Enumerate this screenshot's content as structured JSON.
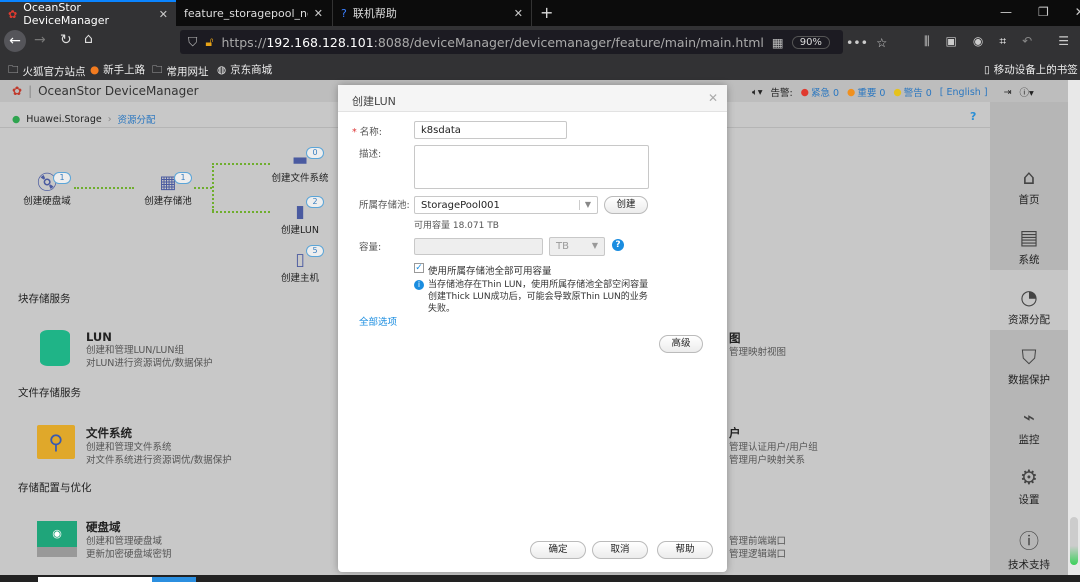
{
  "browser": {
    "tabs": [
      {
        "label": "OceanStor DeviceManager",
        "active": true
      },
      {
        "label": "feature_storagepool_normal.png",
        "active": false
      },
      {
        "label": "联机帮助",
        "active": false
      }
    ],
    "url_prefix": "https://",
    "url_host": "192.168.128.101",
    "url_rest": ":8088/deviceManager/devicemanager/feature/main/main.html",
    "zoom": "90%",
    "bookmarks": [
      "火狐官方站点",
      "新手上路",
      "常用网址",
      "京东商城"
    ],
    "mobile_bookmarks": "移动设备上的书签"
  },
  "app": {
    "title": "OceanStor DeviceManager",
    "alarm_label": "告警:",
    "alarms": [
      {
        "label": "紧急 0",
        "color": "#e03a2f"
      },
      {
        "label": "重要 0",
        "color": "#f0901e"
      },
      {
        "label": "警告 0",
        "color": "#e6c21c"
      }
    ],
    "language": "[ English ]",
    "breadcrumb": {
      "root": "Huawei.Storage",
      "current": "资源分配"
    },
    "help": "?"
  },
  "flow": {
    "nodes": [
      {
        "label": "创建硬盘域",
        "count": "1"
      },
      {
        "label": "创建存储池",
        "count": "1"
      },
      {
        "label": "创建文件系统",
        "count": "0"
      },
      {
        "label": "创建LUN",
        "count": "2"
      },
      {
        "label": "创建主机",
        "count": "5"
      }
    ]
  },
  "sections": [
    {
      "title": "块存储服务",
      "card": {
        "title": "LUN",
        "desc1": "创建和管理LUN/LUN组",
        "desc2": "对LUN进行资源调优/数据保护"
      },
      "right": {
        "title": "图",
        "desc1": "管理映射视图",
        "desc2": ""
      }
    },
    {
      "title": "文件存储服务",
      "card": {
        "title": "文件系统",
        "desc1": "创建和管理文件系统",
        "desc2": "对文件系统进行资源调优/数据保护"
      },
      "right": {
        "title": "户",
        "desc1": "管理认证用户/用户组",
        "desc2": "管理用户映射关系"
      }
    },
    {
      "title": "存储配置与优化",
      "card": {
        "title": "硬盘域",
        "desc1": "创建和管理硬盘域",
        "desc2": "更新加密硬盘域密钥"
      },
      "right": {
        "title": "",
        "desc1": "管理前端端口",
        "desc2": "管理逻辑端口"
      }
    }
  ],
  "sidebar": {
    "items": [
      {
        "label": "首页",
        "icon": "home-icon"
      },
      {
        "label": "系统",
        "icon": "system-icon"
      },
      {
        "label": "资源分配",
        "icon": "resource-icon",
        "selected": true
      },
      {
        "label": "数据保护",
        "icon": "shield-icon"
      },
      {
        "label": "监控",
        "icon": "monitor-icon"
      },
      {
        "label": "设置",
        "icon": "gear-icon"
      },
      {
        "label": "技术支持",
        "icon": "help-icon"
      }
    ]
  },
  "dialog": {
    "title": "创建LUN",
    "name_label": "名称:",
    "name_value": "k8sdata",
    "desc_label": "描述:",
    "desc_value": "",
    "pool_label": "所属存储池:",
    "pool_value": "StoragePool001",
    "create_btn": "创建",
    "available": "可用容量 18.071 TB",
    "capacity_label": "容量:",
    "capacity_value": "",
    "unit": "TB",
    "use_all_label": "使用所属存储池全部可用容量",
    "use_all_checked": true,
    "info1": "当存储池存在Thin LUN，使用所属存储池全部空闲容量",
    "info2": "创建Thick LUN成功后，可能会导致原Thin LUN的业务",
    "info3": "失败。",
    "all_options": "全部选项",
    "advanced": "高级",
    "ok": "确定",
    "cancel": "取消",
    "help": "帮助"
  }
}
